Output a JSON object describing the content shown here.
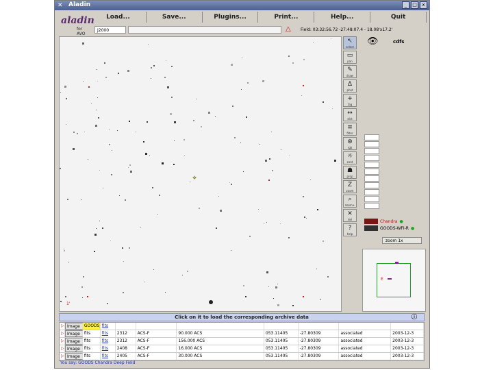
{
  "window": {
    "title": "Aladin"
  },
  "menu": [
    "Load...",
    "Save...",
    "Plugins...",
    "Print...",
    "Help...",
    "Quit"
  ],
  "logo": {
    "name": "aladin",
    "sub": "for AVO"
  },
  "epoch": "J2000",
  "command_value": "",
  "field_readout": "Field: 03:32:56.72 -27:48:07.4 - 18.08'x17.2'",
  "tools": [
    {
      "icon": "select-icon",
      "glyph": "↖",
      "label": "select",
      "selected": true
    },
    {
      "icon": "pan-icon",
      "glyph": "▭",
      "label": "pan"
    },
    {
      "icon": "draw-icon",
      "glyph": "✎",
      "label": "draw"
    },
    {
      "icon": "phot-icon",
      "glyph": "∆",
      "label": "phot"
    },
    {
      "icon": "crosshair-icon",
      "glyph": "+",
      "label": "tag"
    },
    {
      "icon": "dist-icon",
      "glyph": "↔",
      "label": "dist"
    },
    {
      "icon": "filter-icon",
      "glyph": "≡",
      "label": "filter"
    },
    {
      "icon": "rgb-icon",
      "glyph": "⊛",
      "label": "rgb"
    },
    {
      "icon": "cont-icon",
      "glyph": "☼",
      "label": "cont"
    },
    {
      "icon": "prop-icon",
      "glyph": "☗",
      "label": "prop"
    },
    {
      "icon": "zoom-tool-icon",
      "glyph": "Z",
      "label": "zoom"
    },
    {
      "icon": "search-icon",
      "glyph": "⌕",
      "label": "zoom+"
    },
    {
      "icon": "delete-icon",
      "glyph": "✕",
      "label": "del"
    },
    {
      "icon": "help-icon",
      "glyph": "?",
      "label": "help"
    }
  ],
  "view_label": "cdfs",
  "archives": [
    {
      "name": "Chandra",
      "status_color": "#1aa31a"
    },
    {
      "name": "GOODS-WFI-R",
      "status_color": "#1aa31a"
    }
  ],
  "zoom": "zoom 1x",
  "scale_label": "1'",
  "click_banner": "Click on it to load the corresponding archive data",
  "table": [
    {
      "type": "Image",
      "status": "GOODS_CDFS",
      "fmt": "fits",
      "size": "",
      "ra": "",
      "desc": "",
      "coord1": "",
      "coord2": "",
      "proc": "",
      "date": ""
    },
    {
      "type": "Image",
      "status": "fits",
      "fmt": "fits",
      "size": "2312",
      "ra": "ACS-F",
      "desc": "90.000 ACS",
      "coord1": "053.11405",
      "coord2": "-27.80309",
      "proc": "associated",
      "date": "2003-12-3"
    },
    {
      "type": "Image",
      "status": "fits",
      "fmt": "fits",
      "size": "2312",
      "ra": "ACS-F",
      "desc": "156.000 ACS",
      "coord1": "053.11405",
      "coord2": "-27.80309",
      "proc": "associated",
      "date": "2003-12-3"
    },
    {
      "type": "Image",
      "status": "fits",
      "fmt": "fits",
      "size": "2408",
      "ra": "ACS-F",
      "desc": "16.000 ACS",
      "coord1": "053.11405",
      "coord2": "-27.80309",
      "proc": "associated",
      "date": "2003-12-3"
    },
    {
      "type": "Image",
      "status": "fits",
      "fmt": "fits",
      "size": "2405",
      "ra": "ACS-F",
      "desc": "30.000 ACS",
      "coord1": "053.11405",
      "coord2": "-27.80309",
      "proc": "associated",
      "date": "2003-12-3"
    }
  ],
  "status": "You say: GOODS Chandra Deep Field"
}
